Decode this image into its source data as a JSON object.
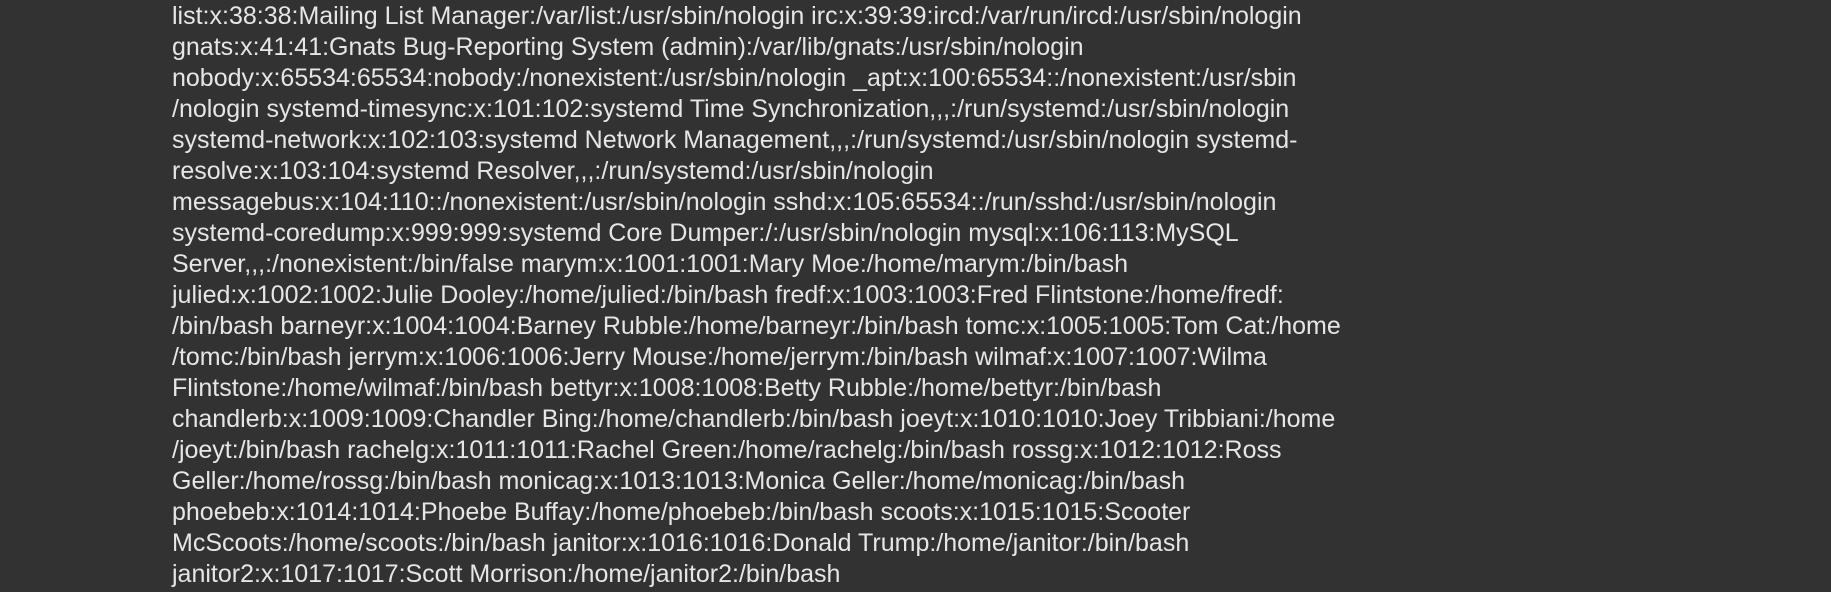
{
  "lines": [
    "list:x:38:38:Mailing List Manager:/var/list:/usr/sbin/nologin irc:x:39:39:ircd:/var/run/ircd:/usr/sbin/nologin",
    "gnats:x:41:41:Gnats Bug-Reporting System (admin):/var/lib/gnats:/usr/sbin/nologin",
    "nobody:x:65534:65534:nobody:/nonexistent:/usr/sbin/nologin _apt:x:100:65534::/nonexistent:/usr/sbin",
    "/nologin systemd-timesync:x:101:102:systemd Time Synchronization,,,:/run/systemd:/usr/sbin/nologin",
    "systemd-network:x:102:103:systemd Network Management,,,:/run/systemd:/usr/sbin/nologin systemd-",
    "resolve:x:103:104:systemd Resolver,,,:/run/systemd:/usr/sbin/nologin",
    "messagebus:x:104:110::/nonexistent:/usr/sbin/nologin sshd:x:105:65534::/run/sshd:/usr/sbin/nologin",
    "systemd-coredump:x:999:999:systemd Core Dumper:/:/usr/sbin/nologin mysql:x:106:113:MySQL",
    "Server,,,:/nonexistent:/bin/false marym:x:1001:1001:Mary Moe:/home/marym:/bin/bash",
    "julied:x:1002:1002:Julie Dooley:/home/julied:/bin/bash fredf:x:1003:1003:Fred Flintstone:/home/fredf:",
    "/bin/bash barneyr:x:1004:1004:Barney Rubble:/home/barneyr:/bin/bash tomc:x:1005:1005:Tom Cat:/home",
    "/tomc:/bin/bash jerrym:x:1006:1006:Jerry Mouse:/home/jerrym:/bin/bash wilmaf:x:1007:1007:Wilma",
    "Flintstone:/home/wilmaf:/bin/bash bettyr:x:1008:1008:Betty Rubble:/home/bettyr:/bin/bash",
    "chandlerb:x:1009:1009:Chandler Bing:/home/chandlerb:/bin/bash joeyt:x:1010:1010:Joey Tribbiani:/home",
    "/joeyt:/bin/bash rachelg:x:1011:1011:Rachel Green:/home/rachelg:/bin/bash rossg:x:1012:1012:Ross",
    "Geller:/home/rossg:/bin/bash monicag:x:1013:1013:Monica Geller:/home/monicag:/bin/bash",
    "phoebeb:x:1014:1014:Phoebe Buffay:/home/phoebeb:/bin/bash scoots:x:1015:1015:Scooter",
    "McScoots:/home/scoots:/bin/bash janitor:x:1016:1016:Donald Trump:/home/janitor:/bin/bash",
    "janitor2:x:1017:1017:Scott Morrison:/home/janitor2:/bin/bash"
  ],
  "colors": {
    "background": "#323232",
    "text": "#e6e6e6"
  }
}
